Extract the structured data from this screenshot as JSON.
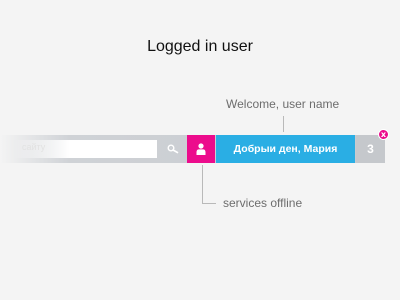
{
  "page": {
    "title": "Logged in user"
  },
  "callouts": {
    "welcome": "Welcome, user name",
    "offline": "services offline"
  },
  "toolbar": {
    "search_placeholder": "сайту",
    "greeting": "Добрыи ден, Мария",
    "count": "3",
    "close_glyph": "x",
    "icons": {
      "search": "search-icon",
      "user": "user-icon",
      "close": "close-icon"
    }
  },
  "colors": {
    "accent_pink": "#ec0c8c",
    "accent_blue": "#2aaee4",
    "bar_gray": "#c7cacf"
  }
}
